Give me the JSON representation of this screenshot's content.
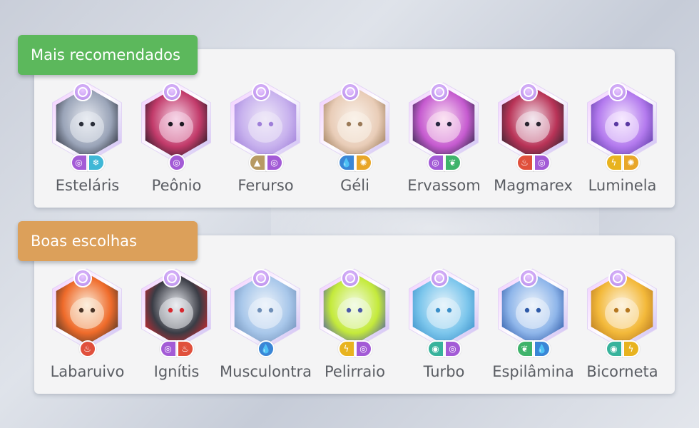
{
  "sections": [
    {
      "title": "Mais recomendados",
      "color": "#5cb85c",
      "pokemon": [
        {
          "name": "Esteláris",
          "icon": "pokemon-portrait",
          "palette": [
            "#e9ecf2",
            "#9aa4b8",
            "#2b2f3a"
          ],
          "types": [
            {
              "kind": "psychic-icon",
              "color": "#a35bd6",
              "glyph": "◎"
            },
            {
              "kind": "ice-icon",
              "color": "#3fb7d6",
              "glyph": "❄"
            }
          ]
        },
        {
          "name": "Peônio",
          "icon": "pokemon-portrait",
          "palette": [
            "#f6d6e8",
            "#c23a6a",
            "#1d1a22"
          ],
          "types": [
            {
              "kind": "psychic-icon",
              "color": "#a35bd6",
              "glyph": "◎"
            }
          ]
        },
        {
          "name": "Ferurso",
          "icon": "pokemon-portrait",
          "palette": [
            "#efe9f8",
            "#c8b2ee",
            "#9f7fd9"
          ],
          "types": [
            {
              "kind": "ground-icon",
              "color": "#b79a63",
              "glyph": "▲"
            },
            {
              "kind": "psychic-icon",
              "color": "#a35bd6",
              "glyph": "◎"
            }
          ]
        },
        {
          "name": "Géli",
          "icon": "pokemon-portrait",
          "palette": [
            "#faf2ea",
            "#e9cdb8",
            "#9b7a58"
          ],
          "types": [
            {
              "kind": "water-icon",
              "color": "#3a86d6",
              "glyph": "💧"
            },
            {
              "kind": "fire-sun-icon",
              "color": "#e8a629",
              "glyph": "✺"
            }
          ]
        },
        {
          "name": "Ervassom",
          "icon": "pokemon-portrait",
          "palette": [
            "#fbe3f3",
            "#c65bd0",
            "#2a2842"
          ],
          "types": [
            {
              "kind": "psychic-icon",
              "color": "#a35bd6",
              "glyph": "◎"
            },
            {
              "kind": "grass-icon",
              "color": "#3fb36b",
              "glyph": "❦"
            }
          ]
        },
        {
          "name": "Magmarex",
          "icon": "pokemon-portrait",
          "palette": [
            "#f3e7ef",
            "#b93357",
            "#2a2530"
          ],
          "types": [
            {
              "kind": "fire-icon",
              "color": "#e0503c",
              "glyph": "♨"
            },
            {
              "kind": "psychic-icon",
              "color": "#a35bd6",
              "glyph": "◎"
            }
          ]
        },
        {
          "name": "Luminela",
          "icon": "pokemon-portrait",
          "palette": [
            "#f6e9ff",
            "#b37aee",
            "#5b3aa3"
          ],
          "types": [
            {
              "kind": "electric-icon",
              "color": "#e8b31f",
              "glyph": "ϟ"
            },
            {
              "kind": "fire-sun-icon",
              "color": "#e8a629",
              "glyph": "✺"
            }
          ]
        }
      ]
    },
    {
      "title": "Boas escolhas",
      "color": "#dca05a",
      "pokemon": [
        {
          "name": "Labaruivo",
          "icon": "pokemon-portrait",
          "palette": [
            "#fbeedd",
            "#ef6b2a",
            "#4a3427"
          ],
          "types": [
            {
              "kind": "fire-icon",
              "color": "#e0503c",
              "glyph": "♨"
            }
          ]
        },
        {
          "name": "Ignítis",
          "icon": "pokemon-portrait",
          "palette": [
            "#eceef3",
            "#3a3c45",
            "#d8272e"
          ],
          "types": [
            {
              "kind": "psychic-icon",
              "color": "#a35bd6",
              "glyph": "◎"
            },
            {
              "kind": "fire-icon",
              "color": "#e0503c",
              "glyph": "♨"
            }
          ]
        },
        {
          "name": "Musculontra",
          "icon": "pokemon-portrait",
          "palette": [
            "#eef4fb",
            "#a8c7ea",
            "#6f8fb8"
          ],
          "types": [
            {
              "kind": "water-icon",
              "color": "#3a86d6",
              "glyph": "💧"
            }
          ]
        },
        {
          "name": "Pelirraio",
          "icon": "pokemon-portrait",
          "palette": [
            "#f3fbe8",
            "#c4ea3b",
            "#4c5aa8"
          ],
          "types": [
            {
              "kind": "electric-icon",
              "color": "#e8b31f",
              "glyph": "ϟ"
            },
            {
              "kind": "psychic-icon",
              "color": "#a35bd6",
              "glyph": "◎"
            }
          ]
        },
        {
          "name": "Turbo",
          "icon": "pokemon-portrait",
          "palette": [
            "#e8f4fb",
            "#7cc6ec",
            "#3a8fc9"
          ],
          "types": [
            {
              "kind": "wind-icon",
              "color": "#38b39c",
              "glyph": "◉"
            },
            {
              "kind": "psychic-icon",
              "color": "#a35bd6",
              "glyph": "◎"
            }
          ]
        },
        {
          "name": "Espilâmina",
          "icon": "pokemon-portrait",
          "palette": [
            "#eef4fb",
            "#8fb6ea",
            "#2e5aa8"
          ],
          "types": [
            {
              "kind": "grass-icon",
              "color": "#3fb36b",
              "glyph": "❦"
            },
            {
              "kind": "water-icon",
              "color": "#3a86d6",
              "glyph": "💧"
            }
          ]
        },
        {
          "name": "Bicorneta",
          "icon": "pokemon-portrait",
          "palette": [
            "#fdf3df",
            "#f3b93a",
            "#b57720"
          ],
          "types": [
            {
              "kind": "wind-icon",
              "color": "#38b39c",
              "glyph": "◉"
            },
            {
              "kind": "electric-icon",
              "color": "#e8b31f",
              "glyph": "ϟ"
            }
          ]
        }
      ]
    }
  ]
}
